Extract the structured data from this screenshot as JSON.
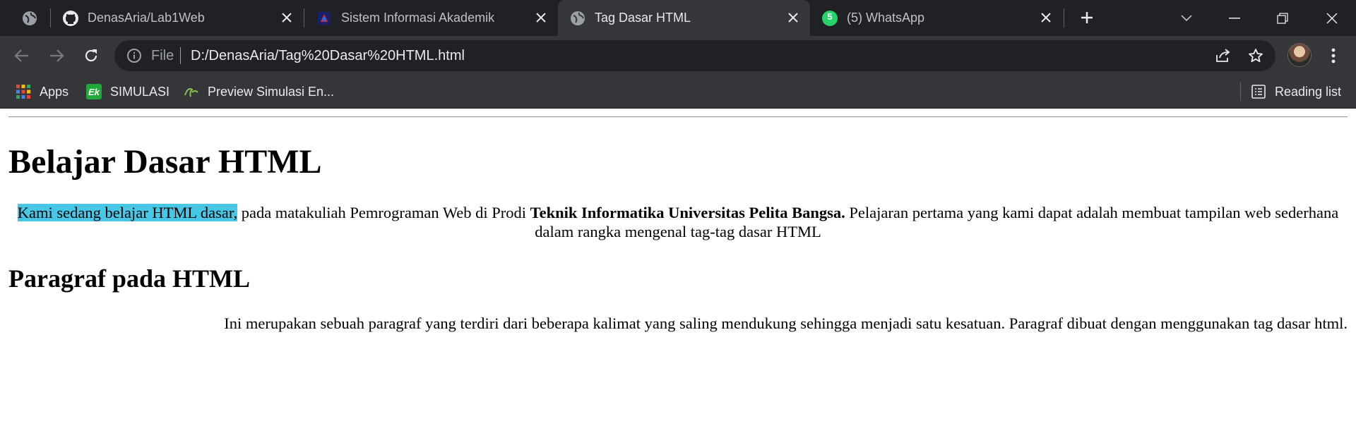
{
  "browser": {
    "tabs": [
      {
        "title": "",
        "icon": "globe-icon",
        "active": false
      },
      {
        "title": "DenasAria/Lab1Web",
        "icon": "github-icon",
        "active": false
      },
      {
        "title": "Sistem Informasi Akademik",
        "icon": "university-logo-icon",
        "active": false
      },
      {
        "title": "Tag Dasar HTML",
        "icon": "globe-icon",
        "active": true
      },
      {
        "title": "(5) WhatsApp",
        "icon": "whatsapp-icon",
        "active": false
      }
    ],
    "whatsapp_badge": "5",
    "address_bar": {
      "scheme_label": "File",
      "url": "D:/DenasAria/Tag%20Dasar%20HTML.html"
    },
    "bookmarks": [
      {
        "label": "Apps",
        "icon": "apps-grid-icon"
      },
      {
        "label": "SIMULASI",
        "icon": "ek-logo-icon"
      },
      {
        "label": "Preview Simulasi En...",
        "icon": "leaf-logo-icon"
      }
    ],
    "reading_list_label": "Reading list",
    "colors": {
      "tabstrip_bg": "#202124",
      "toolbar_bg": "#35363a",
      "omnibox_bg": "#202124",
      "highlight": "#48c6e5"
    }
  },
  "page": {
    "heading": "Belajar Dasar HTML",
    "intro": {
      "highlighted": "Kami sedang belajar HTML dasar,",
      "part1": " pada matakuliah Pemrograman Web di Prodi ",
      "bold": "Teknik Informatika Universitas Pelita Bangsa.",
      "part2": " Pelajaran pertama yang kami dapat adalah membuat tampilan web sederhana dalam rangka mengenal tag-tag dasar HTML"
    },
    "subheading": "Paragraf pada HTML",
    "paragraph": "Ini merupakan sebuah paragraf yang terdiri dari beberapa kalimat yang saling mendukung sehingga menjadi satu kesatuan. Paragraf dibuat dengan menggunakan tag dasar html."
  }
}
